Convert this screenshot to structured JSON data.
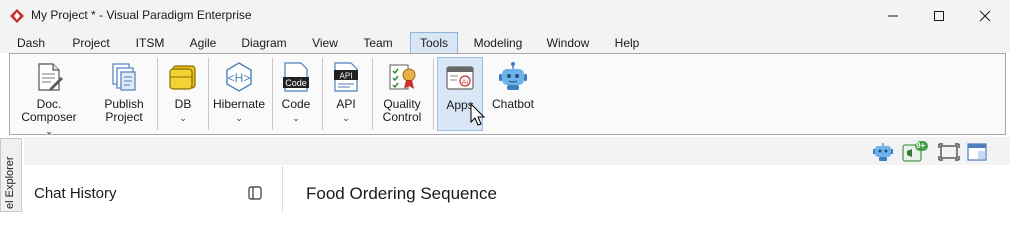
{
  "window": {
    "title": "My Project * - Visual Paradigm Enterprise",
    "controls": [
      "minimize",
      "maximize",
      "close"
    ]
  },
  "menu": {
    "tabs": [
      "Dash",
      "Project",
      "ITSM",
      "Agile",
      "Diagram",
      "View",
      "Team",
      "Tools",
      "Modeling",
      "Window",
      "Help"
    ],
    "active": "Tools"
  },
  "toolbar": {
    "doc_composer": {
      "line1": "Doc.",
      "line2": "Composer"
    },
    "publish_project": {
      "line1": "Publish",
      "line2": "Project"
    },
    "db": {
      "label": "DB"
    },
    "hibernate": {
      "label": "Hibernate"
    },
    "code": {
      "label": "Code",
      "icon_text": "Code"
    },
    "api": {
      "label": "API",
      "icon_text": "API"
    },
    "quality_control": {
      "line1": "Quality",
      "line2": "Control"
    },
    "apps": {
      "label": "Apps",
      "icon_text": "AI"
    },
    "chatbot": {
      "label": "Chatbot"
    }
  },
  "statusbar": {
    "badge": "9+",
    "icons": [
      "chatbot-icon",
      "announcement-icon",
      "fit-screen-icon",
      "layout-icon"
    ]
  },
  "side_tab": {
    "label": "el Explorer"
  },
  "chat_panel": {
    "title": "Chat History"
  },
  "main": {
    "title": "Food Ordering Sequence"
  },
  "colors": {
    "accent": "#d8e6f5",
    "accent_border": "#8fb3d9",
    "brand": "#c8302c"
  }
}
